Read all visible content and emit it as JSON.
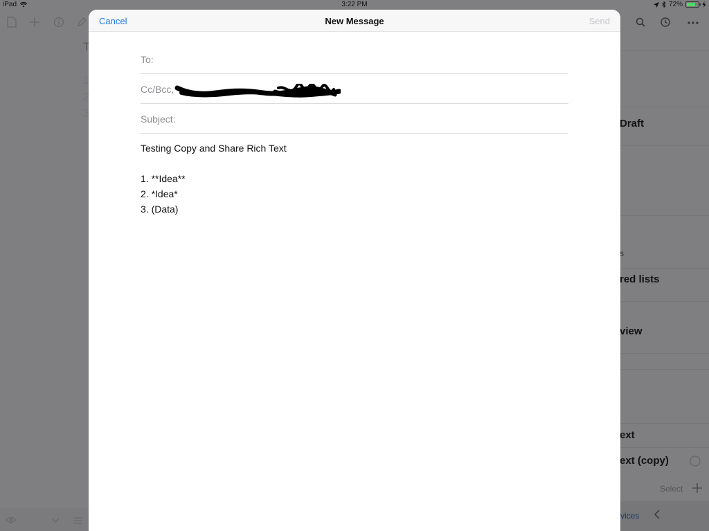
{
  "status_bar": {
    "device": "iPad",
    "time": "3:22 PM",
    "battery_percent": "72%",
    "battery_level": 0.72
  },
  "background_app": {
    "gutter_numbers": [
      "1",
      "2",
      "3"
    ],
    "title_initial": "T",
    "list_items": [
      "Draft",
      "s",
      "red lists",
      "view",
      "ext",
      "ext (copy)"
    ],
    "select_label": "Select",
    "services_link": "vices"
  },
  "compose": {
    "cancel_label": "Cancel",
    "title": "New Message",
    "send_label": "Send",
    "to_label": "To:",
    "to_value": "",
    "cc_label": "Cc/Bcc,",
    "subject_label": "Subject:",
    "subject_value": "",
    "body_lines": [
      "Testing Copy and Share Rich Text",
      "",
      "1. **Idea**",
      "2. *Idea*",
      "3. (Data)"
    ]
  },
  "colors": {
    "accent": "#1f7bea",
    "disabled": "#c7c7cc",
    "overlay": "#7f7f81"
  }
}
